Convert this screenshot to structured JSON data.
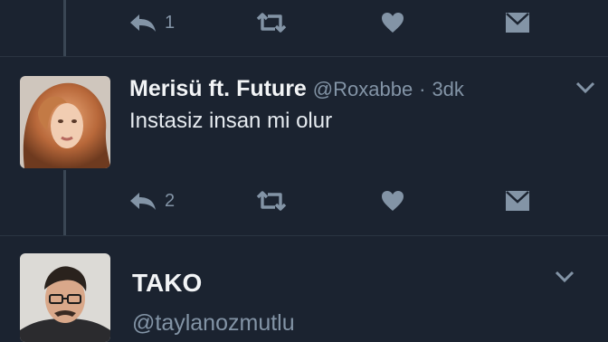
{
  "tweets": [
    {
      "actions": {
        "reply_count": "1"
      }
    },
    {
      "display_name": "Merisü ft. Future",
      "handle": "@Roxabbe",
      "separator": "·",
      "time": "3dk",
      "text": "Instasiz insan mi olur",
      "actions": {
        "reply_count": "2"
      }
    },
    {
      "display_name": "TAKO",
      "handle": "@taylanozmutlu"
    }
  ],
  "icons": {
    "reply": "reply-icon",
    "retweet": "retweet-icon",
    "like": "heart-icon",
    "dm": "envelope-icon",
    "menu": "chevron-down-icon"
  },
  "colors": {
    "background": "#1b2330",
    "icon": "#8394a6",
    "text": "#e6ebf0",
    "thread_line": "#3a4654"
  }
}
